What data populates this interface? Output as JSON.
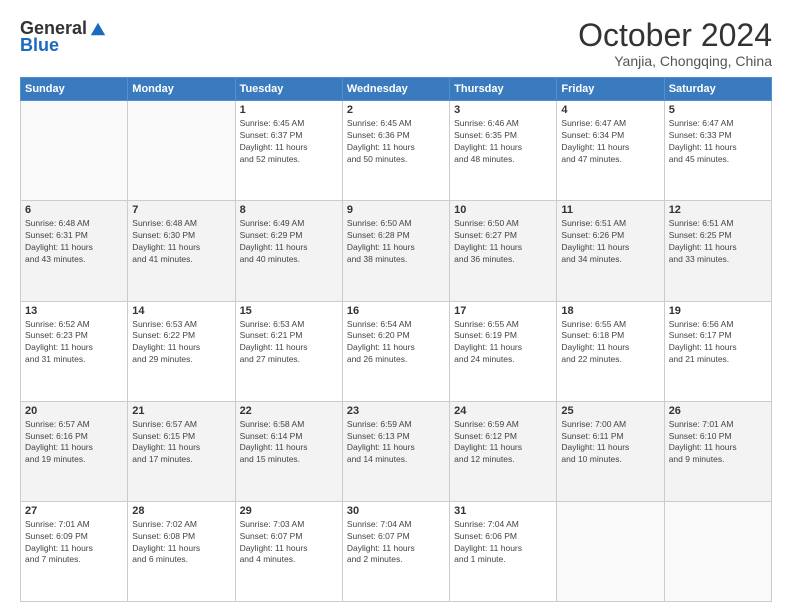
{
  "logo": {
    "general": "General",
    "blue": "Blue"
  },
  "header": {
    "month": "October 2024",
    "location": "Yanjia, Chongqing, China"
  },
  "weekdays": [
    "Sunday",
    "Monday",
    "Tuesday",
    "Wednesday",
    "Thursday",
    "Friday",
    "Saturday"
  ],
  "weeks": [
    [
      {
        "day": "",
        "info": ""
      },
      {
        "day": "",
        "info": ""
      },
      {
        "day": "1",
        "info": "Sunrise: 6:45 AM\nSunset: 6:37 PM\nDaylight: 11 hours\nand 52 minutes."
      },
      {
        "day": "2",
        "info": "Sunrise: 6:45 AM\nSunset: 6:36 PM\nDaylight: 11 hours\nand 50 minutes."
      },
      {
        "day": "3",
        "info": "Sunrise: 6:46 AM\nSunset: 6:35 PM\nDaylight: 11 hours\nand 48 minutes."
      },
      {
        "day": "4",
        "info": "Sunrise: 6:47 AM\nSunset: 6:34 PM\nDaylight: 11 hours\nand 47 minutes."
      },
      {
        "day": "5",
        "info": "Sunrise: 6:47 AM\nSunset: 6:33 PM\nDaylight: 11 hours\nand 45 minutes."
      }
    ],
    [
      {
        "day": "6",
        "info": "Sunrise: 6:48 AM\nSunset: 6:31 PM\nDaylight: 11 hours\nand 43 minutes."
      },
      {
        "day": "7",
        "info": "Sunrise: 6:48 AM\nSunset: 6:30 PM\nDaylight: 11 hours\nand 41 minutes."
      },
      {
        "day": "8",
        "info": "Sunrise: 6:49 AM\nSunset: 6:29 PM\nDaylight: 11 hours\nand 40 minutes."
      },
      {
        "day": "9",
        "info": "Sunrise: 6:50 AM\nSunset: 6:28 PM\nDaylight: 11 hours\nand 38 minutes."
      },
      {
        "day": "10",
        "info": "Sunrise: 6:50 AM\nSunset: 6:27 PM\nDaylight: 11 hours\nand 36 minutes."
      },
      {
        "day": "11",
        "info": "Sunrise: 6:51 AM\nSunset: 6:26 PM\nDaylight: 11 hours\nand 34 minutes."
      },
      {
        "day": "12",
        "info": "Sunrise: 6:51 AM\nSunset: 6:25 PM\nDaylight: 11 hours\nand 33 minutes."
      }
    ],
    [
      {
        "day": "13",
        "info": "Sunrise: 6:52 AM\nSunset: 6:23 PM\nDaylight: 11 hours\nand 31 minutes."
      },
      {
        "day": "14",
        "info": "Sunrise: 6:53 AM\nSunset: 6:22 PM\nDaylight: 11 hours\nand 29 minutes."
      },
      {
        "day": "15",
        "info": "Sunrise: 6:53 AM\nSunset: 6:21 PM\nDaylight: 11 hours\nand 27 minutes."
      },
      {
        "day": "16",
        "info": "Sunrise: 6:54 AM\nSunset: 6:20 PM\nDaylight: 11 hours\nand 26 minutes."
      },
      {
        "day": "17",
        "info": "Sunrise: 6:55 AM\nSunset: 6:19 PM\nDaylight: 11 hours\nand 24 minutes."
      },
      {
        "day": "18",
        "info": "Sunrise: 6:55 AM\nSunset: 6:18 PM\nDaylight: 11 hours\nand 22 minutes."
      },
      {
        "day": "19",
        "info": "Sunrise: 6:56 AM\nSunset: 6:17 PM\nDaylight: 11 hours\nand 21 minutes."
      }
    ],
    [
      {
        "day": "20",
        "info": "Sunrise: 6:57 AM\nSunset: 6:16 PM\nDaylight: 11 hours\nand 19 minutes."
      },
      {
        "day": "21",
        "info": "Sunrise: 6:57 AM\nSunset: 6:15 PM\nDaylight: 11 hours\nand 17 minutes."
      },
      {
        "day": "22",
        "info": "Sunrise: 6:58 AM\nSunset: 6:14 PM\nDaylight: 11 hours\nand 15 minutes."
      },
      {
        "day": "23",
        "info": "Sunrise: 6:59 AM\nSunset: 6:13 PM\nDaylight: 11 hours\nand 14 minutes."
      },
      {
        "day": "24",
        "info": "Sunrise: 6:59 AM\nSunset: 6:12 PM\nDaylight: 11 hours\nand 12 minutes."
      },
      {
        "day": "25",
        "info": "Sunrise: 7:00 AM\nSunset: 6:11 PM\nDaylight: 11 hours\nand 10 minutes."
      },
      {
        "day": "26",
        "info": "Sunrise: 7:01 AM\nSunset: 6:10 PM\nDaylight: 11 hours\nand 9 minutes."
      }
    ],
    [
      {
        "day": "27",
        "info": "Sunrise: 7:01 AM\nSunset: 6:09 PM\nDaylight: 11 hours\nand 7 minutes."
      },
      {
        "day": "28",
        "info": "Sunrise: 7:02 AM\nSunset: 6:08 PM\nDaylight: 11 hours\nand 6 minutes."
      },
      {
        "day": "29",
        "info": "Sunrise: 7:03 AM\nSunset: 6:07 PM\nDaylight: 11 hours\nand 4 minutes."
      },
      {
        "day": "30",
        "info": "Sunrise: 7:04 AM\nSunset: 6:07 PM\nDaylight: 11 hours\nand 2 minutes."
      },
      {
        "day": "31",
        "info": "Sunrise: 7:04 AM\nSunset: 6:06 PM\nDaylight: 11 hours\nand 1 minute."
      },
      {
        "day": "",
        "info": ""
      },
      {
        "day": "",
        "info": ""
      }
    ]
  ]
}
